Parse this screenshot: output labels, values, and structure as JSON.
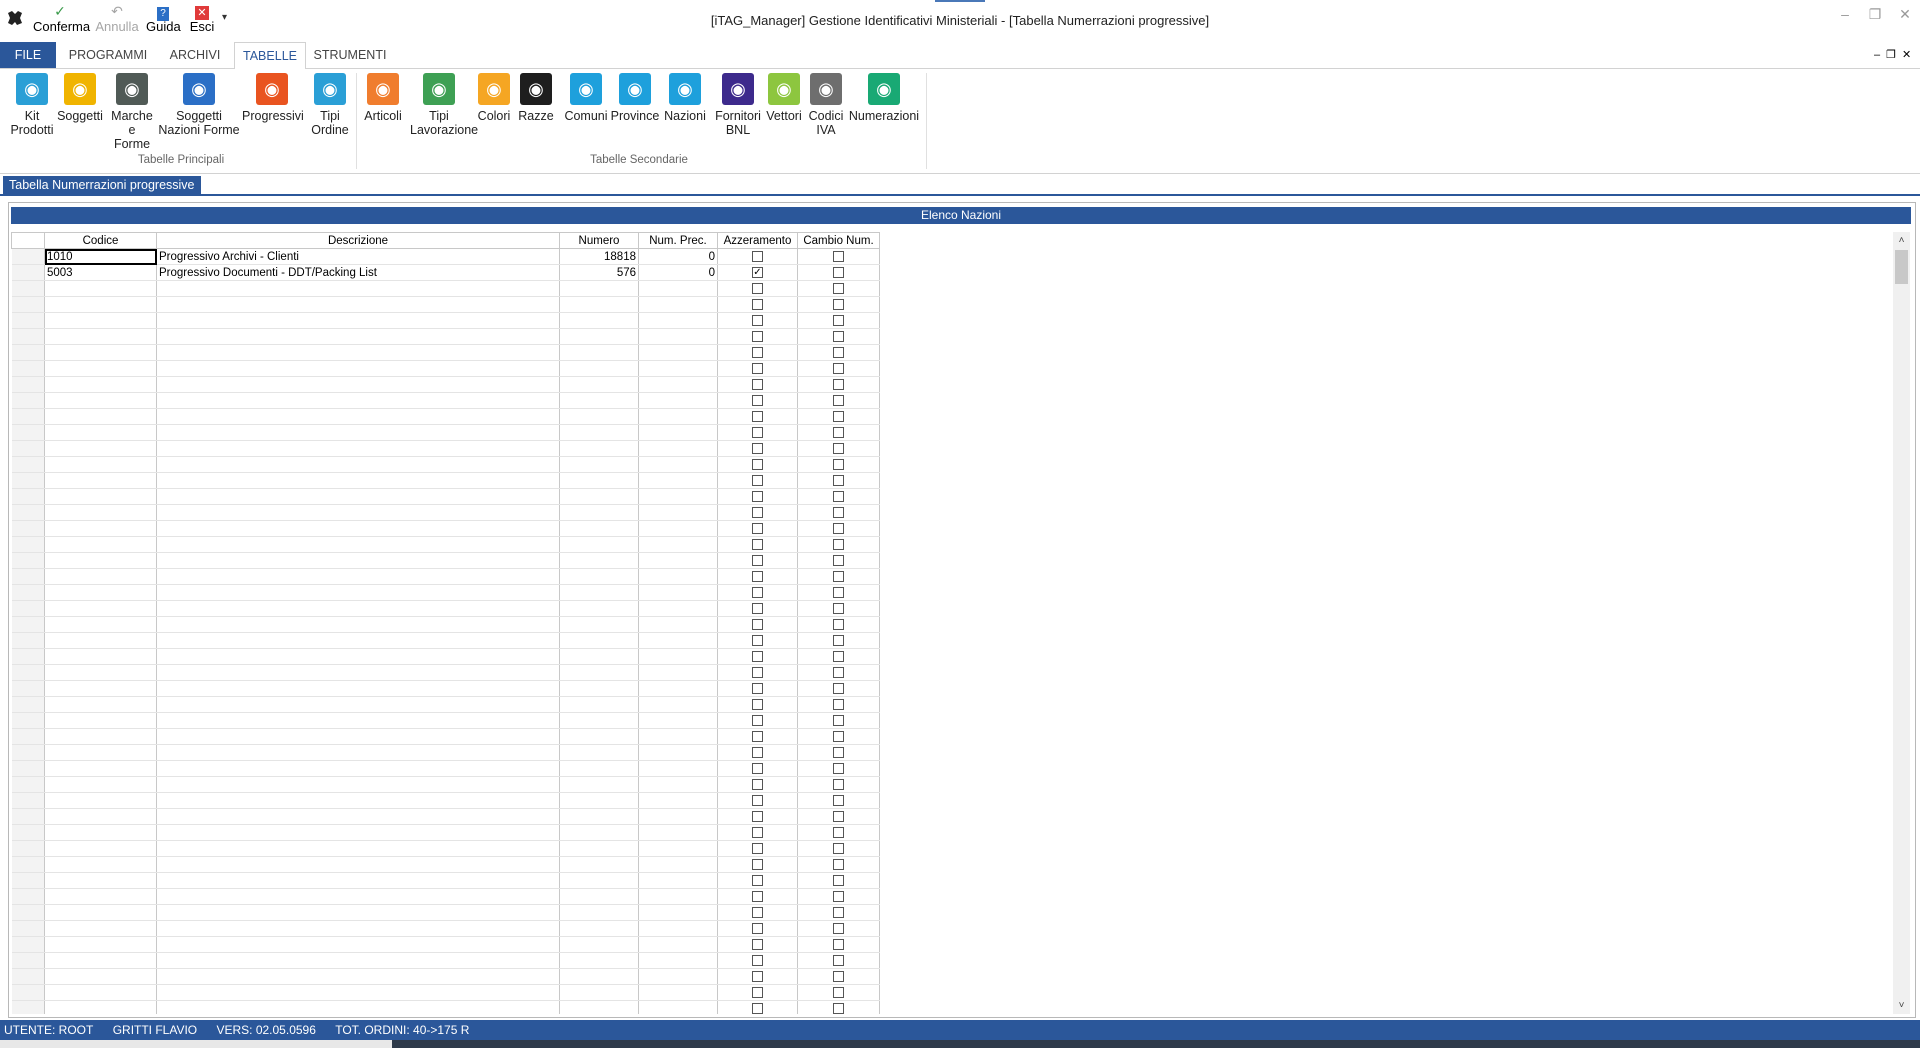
{
  "window": {
    "title": "[iTAG_Manager] Gestione Identificativi Ministeriali - [Tabella Numerrazioni progressive]",
    "minimize": "–",
    "maximize": "❐",
    "close": "✕"
  },
  "quick_access": {
    "confirm": "Conferma",
    "undo": "Annulla",
    "help": "Guida",
    "exit": "Esci",
    "dropdown": "▾"
  },
  "ribbon": {
    "tabs": [
      "FILE",
      "PROGRAMMI",
      "ARCHIVI",
      "TABELLE",
      "STRUMENTI"
    ],
    "active_tab": "TABELLE",
    "mdi_controls": "–❐✕",
    "groups": [
      {
        "label": "Tabelle Principali",
        "items": [
          {
            "label1": "Kit",
            "label2": "Prodotti",
            "icon": "kit-icon",
            "color": "#2a9fd6"
          },
          {
            "label1": "Soggetti",
            "label2": "",
            "icon": "tux-icon",
            "color": "#f0b400"
          },
          {
            "label1": "Marche e",
            "label2": "Forme",
            "icon": "shape-icon",
            "color": "#505a56"
          },
          {
            "label1": "Soggetti",
            "label2": "Nazioni Forme",
            "icon": "grid-icon",
            "color": "#2b6fc6"
          },
          {
            "label1": "Progressivi",
            "label2": "",
            "icon": "ubuntu-icon",
            "color": "#e95420"
          },
          {
            "label1": "Tipi",
            "label2": "Ordine",
            "icon": "balloon-icon",
            "color": "#2a9fd6"
          }
        ]
      },
      {
        "label": "Tabelle Secondarie",
        "items": [
          {
            "label1": "Articoli",
            "label2": "",
            "icon": "star-outline-icon",
            "color": "#f07d2e"
          },
          {
            "label1": "Tipi",
            "label2": "Lavorazione",
            "icon": "eye-icon",
            "color": "#3ea054"
          },
          {
            "label1": "Colori",
            "label2": "",
            "icon": "color-icon",
            "color": "#f5a623"
          },
          {
            "label1": "Razze",
            "label2": "",
            "icon": "cap-icon",
            "color": "#1e1e1e"
          },
          {
            "label1": "Comuni",
            "label2": "",
            "icon": "folder-icon",
            "color": "#1ea0dc"
          },
          {
            "label1": "Province",
            "label2": "",
            "icon": "folder-star-icon",
            "color": "#1ea0dc"
          },
          {
            "label1": "Nazioni",
            "label2": "",
            "icon": "folder-flag-icon",
            "color": "#1ea0dc"
          },
          {
            "label1": "Fornitori",
            "label2": "BNL",
            "icon": "moon-icon",
            "color": "#3d2a8c"
          },
          {
            "label1": "Vettori",
            "label2": "",
            "icon": "android-icon",
            "color": "#8dc63f"
          },
          {
            "label1": "Codici",
            "label2": "IVA",
            "icon": "triangle-icon",
            "color": "#6e6e6e"
          },
          {
            "label1": "Numerazioni",
            "label2": "",
            "icon": "globe-grid-icon",
            "color": "#19a974"
          }
        ]
      }
    ]
  },
  "document_tab": "Tabella Numerrazioni progressive",
  "panel": {
    "header": "Elenco Nazioni",
    "columns": [
      "Codice",
      "Descrizione",
      "Numero",
      "Num. Prec.",
      "Azzeramento",
      "Cambio Num."
    ],
    "rows": [
      {
        "codice": "1010",
        "descrizione": "Progressivo Archivi - Clienti",
        "numero": "18818",
        "num_prec": "0",
        "azzeramento": false,
        "cambio": false
      },
      {
        "codice": "5003",
        "descrizione": "Progressivo Documenti - DDT/Packing List",
        "numero": "576",
        "num_prec": "0",
        "azzeramento": true,
        "cambio": false
      }
    ],
    "scroll_up": "˄",
    "scroll_down": "˅"
  },
  "statusbar": {
    "user": "UTENTE: ROOT",
    "name": "GRITTI FLAVIO",
    "version": "VERS: 02.05.0596",
    "orders": "TOT. ORDINI: 40->175 R"
  },
  "colors": {
    "accent": "#2b579a"
  }
}
